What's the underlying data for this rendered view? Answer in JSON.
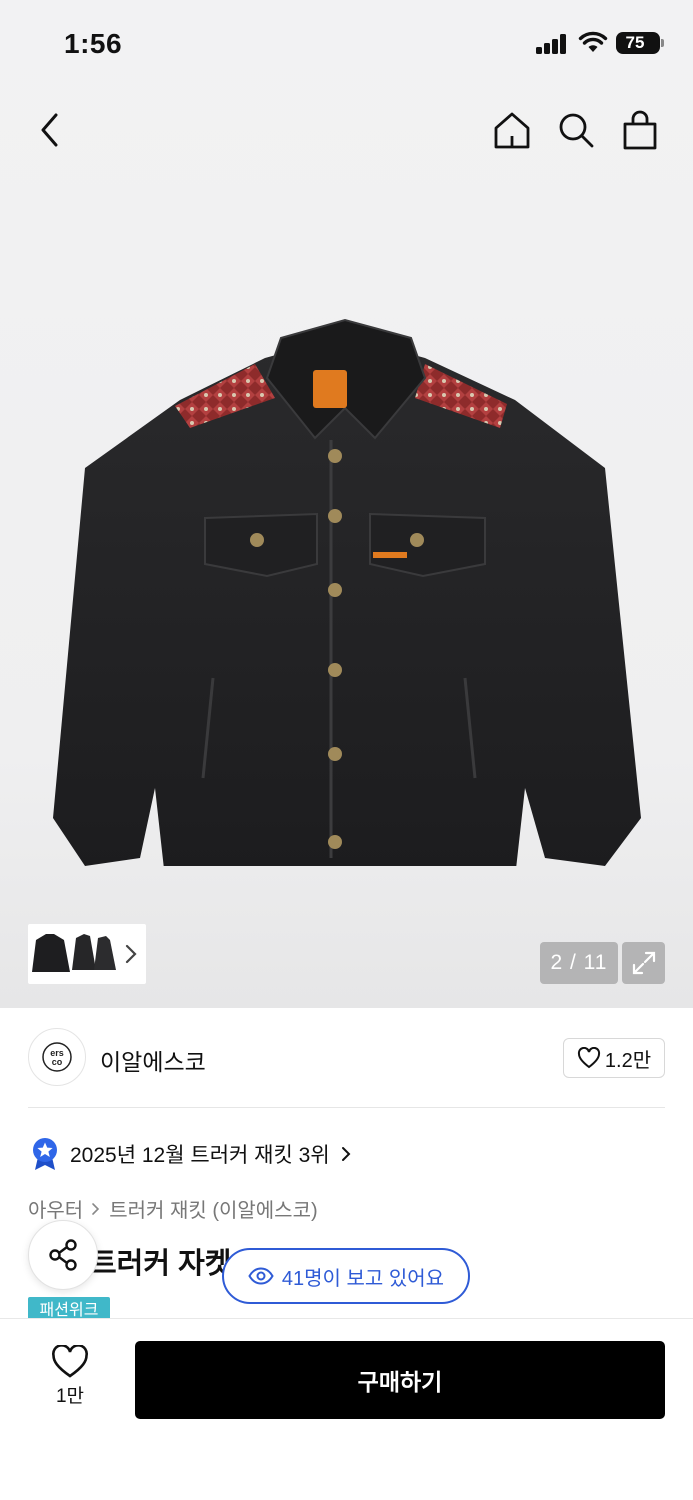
{
  "status_bar": {
    "time": "1:56",
    "battery": "75"
  },
  "gallery": {
    "current": 2,
    "total": 11,
    "counter": "2 / 11"
  },
  "brand": {
    "name": "이알에스코",
    "likes": "1.2만",
    "logo_text": "ers co"
  },
  "ranking": {
    "text": "2025년 12월 트러커 재킷 3위"
  },
  "breadcrumb": {
    "category": "아우터",
    "subcategory": "트러커 재킷 (이알에스코)"
  },
  "product": {
    "title_partial": "트러커 자켓"
  },
  "viewers": {
    "text": "41명이 보고 있어요"
  },
  "tag": {
    "label": "패션위크"
  },
  "bottom": {
    "like_count": "1만",
    "buy_label": "구매하기"
  },
  "colors": {
    "accent_blue": "#2f5bd6",
    "tag_teal": "#40b8c9",
    "buy_bg": "#000000"
  }
}
